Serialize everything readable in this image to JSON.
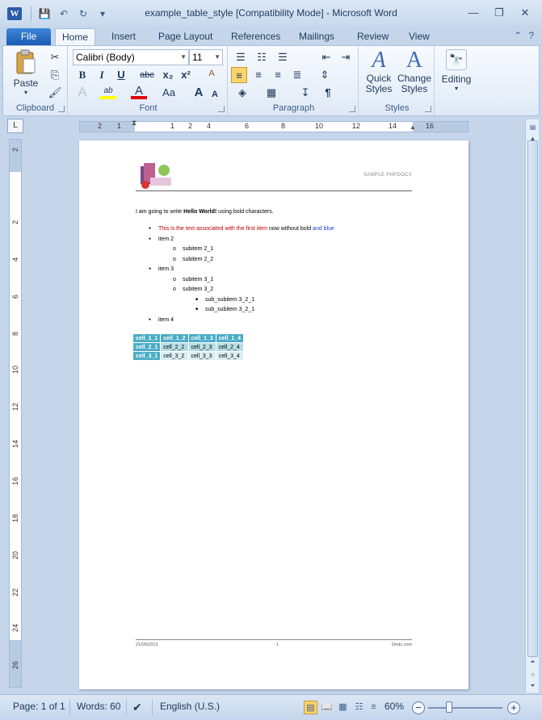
{
  "window": {
    "title": "example_table_style [Compatibility Mode]  -  Microsoft Word",
    "app_icon": "W"
  },
  "qat": {
    "save_icon": "💾",
    "undo_icon": "↶",
    "redo_icon": "↻",
    "customize_icon": "▾"
  },
  "winctl": {
    "minimize": "—",
    "restore": "❐",
    "close": "✕"
  },
  "tabs": [
    "File",
    "Home",
    "Insert",
    "Page Layout",
    "References",
    "Mailings",
    "Review",
    "View"
  ],
  "ribbon_right": {
    "collapse_icon": "⌃",
    "help_icon": "?"
  },
  "ribbon": {
    "clipboard": {
      "label": "Clipboard",
      "paste": "Paste",
      "cut_icon": "✂",
      "copy_icon": "⎘",
      "format_painter_icon": "🖌"
    },
    "font": {
      "label": "Font",
      "font_name": "Calibri (Body)",
      "font_size": "11",
      "bold": "B",
      "italic": "I",
      "underline": "U",
      "strike": "abc",
      "subscript": "x₂",
      "superscript": "x²",
      "clear": "A",
      "text_effects": "A",
      "highlight": "ab",
      "font_color": "A",
      "change_case": "Aa",
      "grow": "A",
      "shrink": "A"
    },
    "paragraph": {
      "label": "Paragraph",
      "show_marks": "¶"
    },
    "styles": {
      "label": "Styles",
      "quick": "Quick Styles",
      "change": "Change Styles"
    },
    "editing": {
      "label": "Editing"
    }
  },
  "ruler": {
    "corner_icon": "L",
    "h_numbers": [
      "2",
      "1",
      "1",
      "2",
      "4",
      "6",
      "8",
      "10",
      "12",
      "14",
      "16"
    ],
    "v_numbers": [
      "2",
      "2",
      "4",
      "6",
      "8",
      "10",
      "12",
      "14",
      "16",
      "18",
      "20",
      "22",
      "24",
      "26"
    ]
  },
  "document": {
    "header_text": "SAMPLE PHPDOCX",
    "line1_pre": "I am going to write ",
    "line1_bold": "Hello World!",
    "line1_post": " using bold characters.",
    "list": [
      {
        "level": 1,
        "parts": [
          {
            "text": "This is the text associated with the first item",
            "style": "red"
          },
          {
            "text": " now without bold ",
            "style": ""
          },
          {
            "text": "and blue",
            "style": "blue"
          }
        ]
      },
      {
        "level": 1,
        "parts": [
          {
            "text": "item 2",
            "style": ""
          }
        ]
      },
      {
        "level": 2,
        "parts": [
          {
            "text": "subitem 2_1",
            "style": ""
          }
        ]
      },
      {
        "level": 2,
        "parts": [
          {
            "text": "subitem 2_2",
            "style": ""
          }
        ]
      },
      {
        "level": 1,
        "parts": [
          {
            "text": "item 3",
            "style": ""
          }
        ]
      },
      {
        "level": 2,
        "parts": [
          {
            "text": "subitem 3_1",
            "style": ""
          }
        ]
      },
      {
        "level": 2,
        "parts": [
          {
            "text": "subitem 3_2",
            "style": ""
          }
        ]
      },
      {
        "level": 3,
        "parts": [
          {
            "text": "sub_subitem 3_2_1",
            "style": ""
          }
        ]
      },
      {
        "level": 3,
        "parts": [
          {
            "text": "sub_subitem 3_2_1",
            "style": ""
          }
        ]
      },
      {
        "level": 1,
        "parts": [
          {
            "text": "item 4",
            "style": ""
          }
        ]
      }
    ],
    "table": [
      [
        "cell_1_1",
        "cell_1_2",
        "cell_1_3",
        "cell_1_4"
      ],
      [
        "cell_2_1",
        "cell_2_2",
        "cell_2_3",
        "cell_2_4"
      ],
      [
        "cell_3_1",
        "cell_3_2",
        "cell_3_3",
        "cell_3_4"
      ]
    ],
    "footer_date": "21/05/2013",
    "footer_page": "1",
    "footer_site": "2mdc.com"
  },
  "status": {
    "page": "Page: 1 of 1",
    "words": "Words: 60",
    "language": "English (U.S.)",
    "zoom": "60%",
    "zoom_level_fraction": 0.6
  }
}
